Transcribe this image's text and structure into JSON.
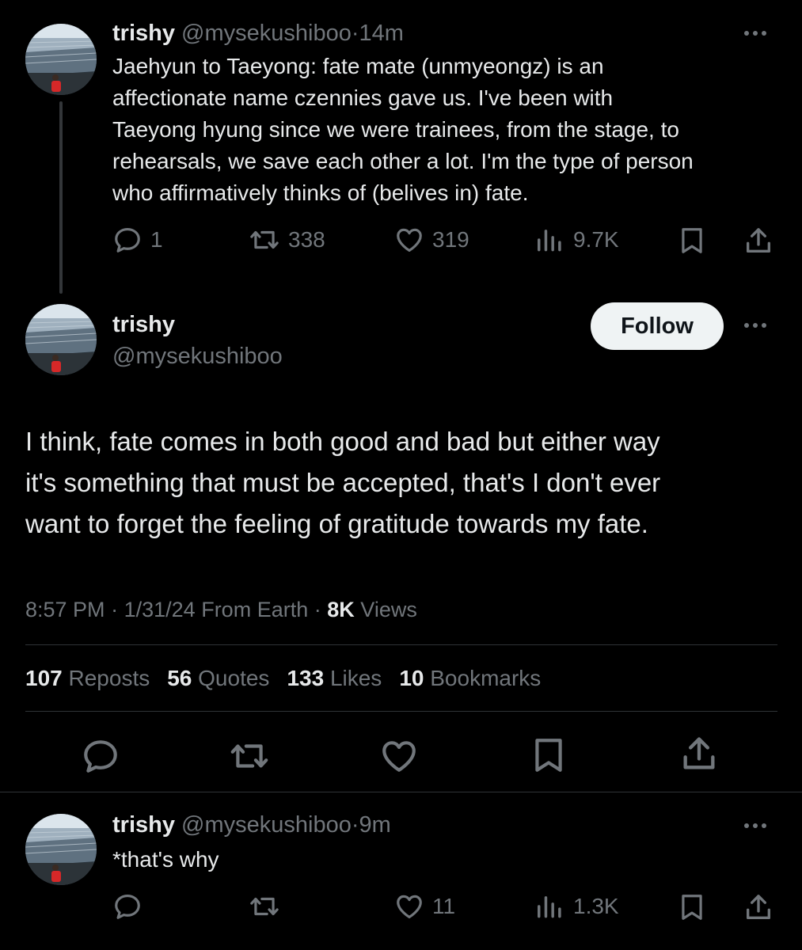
{
  "tweet1": {
    "author_name": "trishy",
    "handle": "@mysekushiboo",
    "sep": "·",
    "time": "14m",
    "text_lines": [
      "Jaehyun to Taeyong: fate mate (unmyeongz) is an",
      "affectionate name czennies gave us. I've been with",
      "Taeyong hyung since we were trainees, from the stage, to",
      "rehearsals, we save each other a lot. I'm the type of person",
      "who affirmatively thinks of (belives in) fate."
    ],
    "replies": "1",
    "reposts": "338",
    "likes": "319",
    "views": "9.7K"
  },
  "main_tweet": {
    "author_name": "trishy",
    "handle": "@mysekushiboo",
    "follow_label": "Follow",
    "text_lines": [
      "I think, fate comes in both good and bad but either way",
      "it's something that must be accepted, that's I don't ever",
      "want to forget the feeling of gratitude towards my fate."
    ],
    "meta_time": "8:57 PM",
    "meta_sep1": "·",
    "meta_date": "1/31/24",
    "meta_location": "From Earth",
    "meta_sep2": "·",
    "views_count": "8K",
    "views_label": "Views",
    "stats": {
      "reposts_count": "107",
      "reposts_label": "Reposts",
      "quotes_count": "56",
      "quotes_label": "Quotes",
      "likes_count": "133",
      "likes_label": "Likes",
      "bookmarks_count": "10",
      "bookmarks_label": "Bookmarks"
    }
  },
  "tweet3": {
    "author_name": "trishy",
    "handle": "@mysekushiboo",
    "sep": "·",
    "time": "9m",
    "text": "*that's why",
    "likes": "11",
    "views": "1.3K"
  },
  "icons": {
    "reply": "reply-icon",
    "repost": "repost-icon",
    "like": "heart-icon",
    "views": "views-icon",
    "bookmark": "bookmark-icon",
    "share": "share-icon",
    "more": "more-icon"
  },
  "colors": {
    "background": "#000000",
    "text": "#e7e9ea",
    "secondary": "#71767b",
    "divider": "#2f3336",
    "follow_bg": "#eff3f4"
  }
}
